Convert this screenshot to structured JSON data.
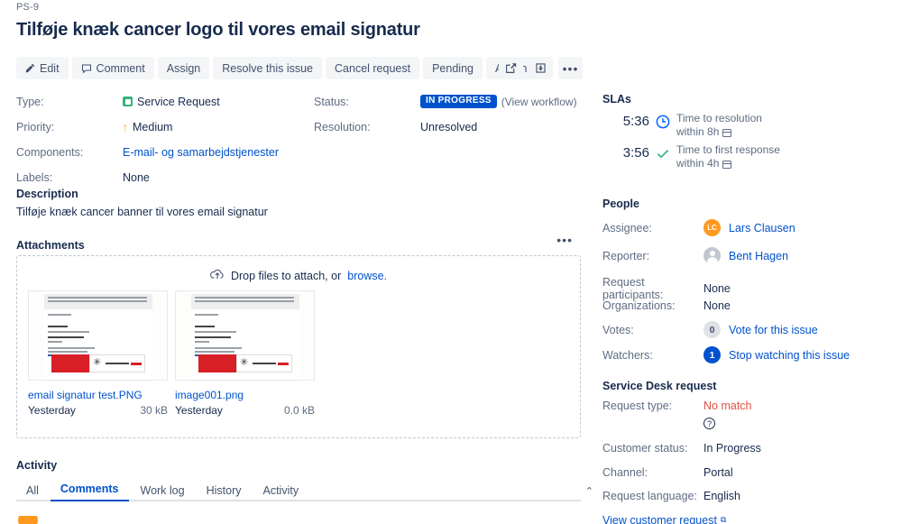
{
  "issue": {
    "key": "PS-9",
    "title": "Tilføje knæk cancer logo til vores email signatur"
  },
  "toolbar": {
    "edit": "Edit",
    "comment": "Comment",
    "assign": "Assign",
    "resolve": "Resolve this issue",
    "cancel": "Cancel request",
    "pending": "Pending",
    "admin": "Admin",
    "caret": "▾"
  },
  "top_actions": {
    "share": "share-icon",
    "export": "export-icon",
    "more": "•••"
  },
  "details": {
    "type_label": "Type:",
    "type_value": "Service Request",
    "priority_label": "Priority:",
    "priority_value": "Medium",
    "priority_arrow": "↑",
    "components_label": "Components:",
    "components_value": "E-mail- og samarbejdstjenester",
    "labels_label": "Labels:",
    "labels_value": "None",
    "status_label": "Status:",
    "status_value": "IN PROGRESS",
    "view_workflow": "(View workflow)",
    "resolution_label": "Resolution:",
    "resolution_value": "Unresolved"
  },
  "description": {
    "heading": "Description",
    "body": "Tilføje knæk cancer banner til vores email signatur"
  },
  "attachments": {
    "heading": "Attachments",
    "more": "•••",
    "drop_text": "Drop files to attach, or",
    "browse": "browse.",
    "items": [
      {
        "name": "email signatur test.PNG",
        "date": "Yesterday",
        "size": "30 kB"
      },
      {
        "name": "image001.png",
        "date": "Yesterday",
        "size": "0.0 kB"
      }
    ]
  },
  "activity": {
    "heading": "Activity",
    "tabs": [
      "All",
      "Comments",
      "Work log",
      "History",
      "Activity"
    ],
    "active_tab": "Comments",
    "collapse": "⌃"
  },
  "slas": {
    "heading": "SLAs",
    "items": [
      {
        "time": "5:36",
        "icon": "clock-icon",
        "title": "Time to resolution",
        "goal": "within 8h"
      },
      {
        "time": "3:56",
        "icon": "check-icon",
        "title": "Time to first response",
        "goal": "within 4h"
      }
    ]
  },
  "people": {
    "heading": "People",
    "assignee_label": "Assignee:",
    "assignee_value": "Lars Clausen",
    "assignee_initials": "LC",
    "reporter_label": "Reporter:",
    "reporter_value": "Bent Hagen",
    "participants_label": "Request participants:",
    "participants_value": "None",
    "organizations_label": "Organizations:",
    "organizations_value": "None",
    "votes_label": "Votes:",
    "votes_count": "0",
    "votes_action": "Vote for this issue",
    "watchers_label": "Watchers:",
    "watchers_count": "1",
    "watchers_action": "Stop watching this issue"
  },
  "service_desk": {
    "heading": "Service Desk request",
    "request_type_label": "Request type:",
    "request_type_value": "No match",
    "help": "?",
    "customer_status_label": "Customer status:",
    "customer_status_value": "In Progress",
    "channel_label": "Channel:",
    "channel_value": "Portal",
    "language_label": "Request language:",
    "language_value": "English",
    "view_request": "View customer request"
  },
  "colors": {
    "accent": "#0052cc",
    "status_badge": "#0052cc",
    "type_green": "#36b37e",
    "priority_orange": "#ff8b00",
    "avatar_orange": "#ff991f",
    "error_red": "#de5343",
    "sla_green": "#36b37e"
  }
}
